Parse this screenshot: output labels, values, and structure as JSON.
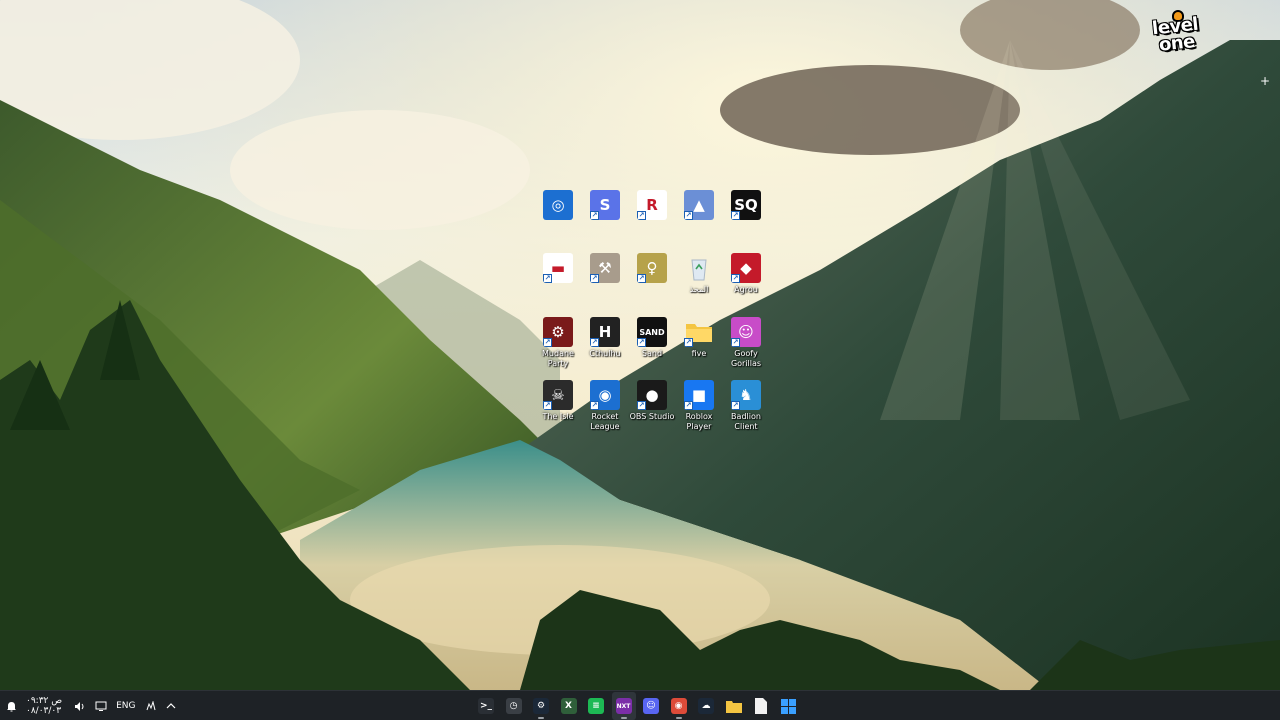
{
  "wallpaper": {
    "watermark_line1": "level",
    "watermark_line2": "one",
    "plus": "+"
  },
  "desktop_icons": [
    {
      "label": "",
      "color": "#1c6fd1",
      "glyph": "◎",
      "name": "camera-app-icon"
    },
    {
      "label": "",
      "color": "#5a73e8",
      "glyph": "S",
      "name": "s-app-icon"
    },
    {
      "label": "",
      "color": "#ffffff",
      "glyph": "R",
      "name": "r-app-icon"
    },
    {
      "label": "",
      "color": "#6b8fd6",
      "glyph": "▲",
      "name": "truck-app-icon"
    },
    {
      "label": "",
      "color": "#111111",
      "glyph": "SQ",
      "name": "sq-app-icon"
    },
    {
      "label": "",
      "color": "#ffffff",
      "glyph": "▬",
      "name": "red-glasses-app-icon"
    },
    {
      "label": "",
      "color": "#a89c8c",
      "glyph": "⚒",
      "name": "brown-app-icon"
    },
    {
      "label": "",
      "color": "#b6a24a",
      "glyph": "♀",
      "name": "sketch-app-icon"
    },
    {
      "label": "المحذ",
      "color": "#eef3f7",
      "glyph": "♻",
      "name": "recycle-bin-icon"
    },
    {
      "label": "Agrou",
      "color": "#c41a2a",
      "glyph": "◆",
      "name": "agrou-app-icon"
    },
    {
      "label": "Mudane Party",
      "color": "#7a1a1a",
      "glyph": "⚙",
      "name": "mudane-party-icon"
    },
    {
      "label": "Cthulhu",
      "color": "#222222",
      "glyph": "H",
      "name": "shield-app-icon"
    },
    {
      "label": "Sand",
      "color": "#111111",
      "glyph": "SAND",
      "name": "sand-app-icon"
    },
    {
      "label": "five",
      "color": "#f4c542",
      "glyph": "",
      "name": "folder-icon"
    },
    {
      "label": "Goofy Gorillas",
      "color": "#c84cc8",
      "glyph": "☺",
      "name": "goofy-gorillas-icon"
    },
    {
      "label": "The Isle",
      "color": "#2b2b2b",
      "glyph": "☠",
      "name": "the-isle-icon"
    },
    {
      "label": "Rocket League",
      "color": "#1c6fd1",
      "glyph": "◉",
      "name": "rocket-league-icon"
    },
    {
      "label": "OBS Studio",
      "color": "#1a1a1a",
      "glyph": "●",
      "name": "obs-studio-icon"
    },
    {
      "label": "Roblox Player",
      "color": "#1877f2",
      "glyph": "■",
      "name": "roblox-player-icon"
    },
    {
      "label": "Badlion Client",
      "color": "#2a8fd6",
      "glyph": "♞",
      "name": "badlion-client-icon"
    }
  ],
  "taskbar": {
    "clock_time": "۰۹:۳۲ ص",
    "clock_date": "۰۸/۰۳/۰۳",
    "language": "ENG",
    "chevron": "^",
    "apps": [
      {
        "name": "terminal-taskbar-icon",
        "color": "#2a2f35",
        "glyph": ">_",
        "running": false
      },
      {
        "name": "clock-taskbar-icon",
        "color": "#3a3f45",
        "glyph": "◷",
        "running": false
      },
      {
        "name": "steam-taskbar-icon",
        "color": "#1b2838",
        "glyph": "⚙",
        "running": true
      },
      {
        "name": "xbox-taskbar-icon",
        "color": "#2f5f3a",
        "glyph": "X",
        "running": false
      },
      {
        "name": "spotify-taskbar-icon",
        "color": "#1db954",
        "glyph": "≡",
        "running": false
      },
      {
        "name": "next-taskbar-icon",
        "color": "#7b2ea8",
        "glyph": "NXT",
        "running": true
      },
      {
        "name": "discord-taskbar-icon",
        "color": "#5865f2",
        "glyph": "☺",
        "running": false
      },
      {
        "name": "chrome-taskbar-icon",
        "color": "#dd4b39",
        "glyph": "◉",
        "running": true
      },
      {
        "name": "steam2-taskbar-icon",
        "color": "#1b2838",
        "glyph": "☁",
        "running": false
      },
      {
        "name": "file-explorer-taskbar-icon",
        "color": "#f4c542",
        "glyph": "",
        "running": false
      },
      {
        "name": "notepad-taskbar-icon",
        "color": "#f2f2f2",
        "glyph": "",
        "running": false
      },
      {
        "name": "start-taskbar-icon",
        "color": "#2b89e0",
        "glyph": "⊞",
        "running": false
      }
    ]
  }
}
